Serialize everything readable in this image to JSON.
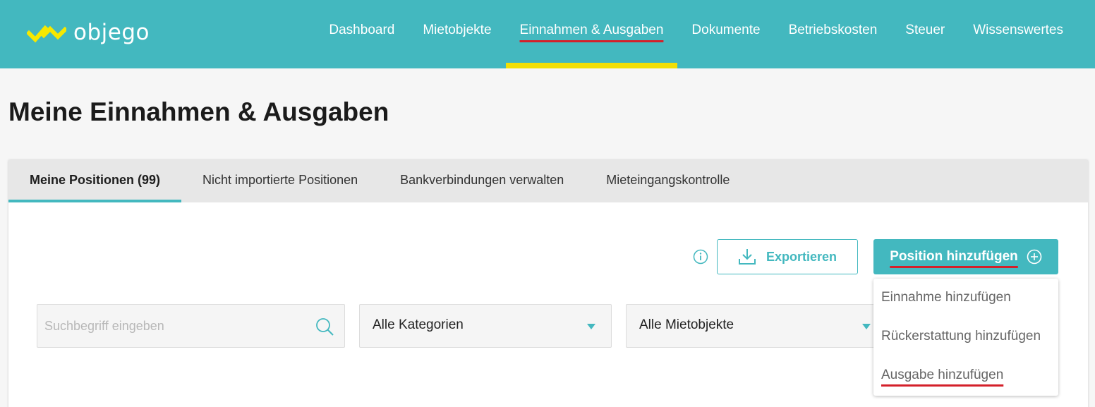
{
  "brand": {
    "name": "objego",
    "colors": {
      "brand": "#43b8bf",
      "accent_yellow": "#f1df05",
      "logo_yellow": "#f6e800",
      "annotation_red": "#d4202a"
    }
  },
  "nav": {
    "items": [
      {
        "label": "Dashboard",
        "active": false
      },
      {
        "label": "Mietobjekte",
        "active": false
      },
      {
        "label": "Einnahmen & Ausgaben",
        "active": true
      },
      {
        "label": "Dokumente",
        "active": false
      },
      {
        "label": "Betriebskosten",
        "active": false
      },
      {
        "label": "Steuer",
        "active": false
      },
      {
        "label": "Wissenswertes",
        "active": false
      }
    ]
  },
  "page": {
    "title": "Meine Einnahmen & Ausgaben"
  },
  "tabs": [
    {
      "label": "Meine Positionen (99)",
      "active": true
    },
    {
      "label": "Nicht importierte Positionen",
      "active": false
    },
    {
      "label": "Bankverbindungen verwalten",
      "active": false
    },
    {
      "label": "Mieteingangskontrolle",
      "active": false
    }
  ],
  "actions": {
    "info_icon": "info-icon",
    "export_label": "Exportieren",
    "export_icon": "download-icon",
    "add_label": "Position hinzufügen",
    "add_icon": "plus-circle-icon"
  },
  "filters": {
    "search": {
      "placeholder": "Suchbegriff eingeben",
      "value": "",
      "icon": "search-icon"
    },
    "category": {
      "selected": "Alle Kategorien"
    },
    "property": {
      "selected": "Alle Mietobjekte"
    }
  },
  "add_menu": {
    "items": [
      {
        "label": "Einnahme hinzufügen"
      },
      {
        "label": "Rückerstattung hinzufügen"
      },
      {
        "label": "Ausgabe hinzufügen"
      }
    ]
  }
}
